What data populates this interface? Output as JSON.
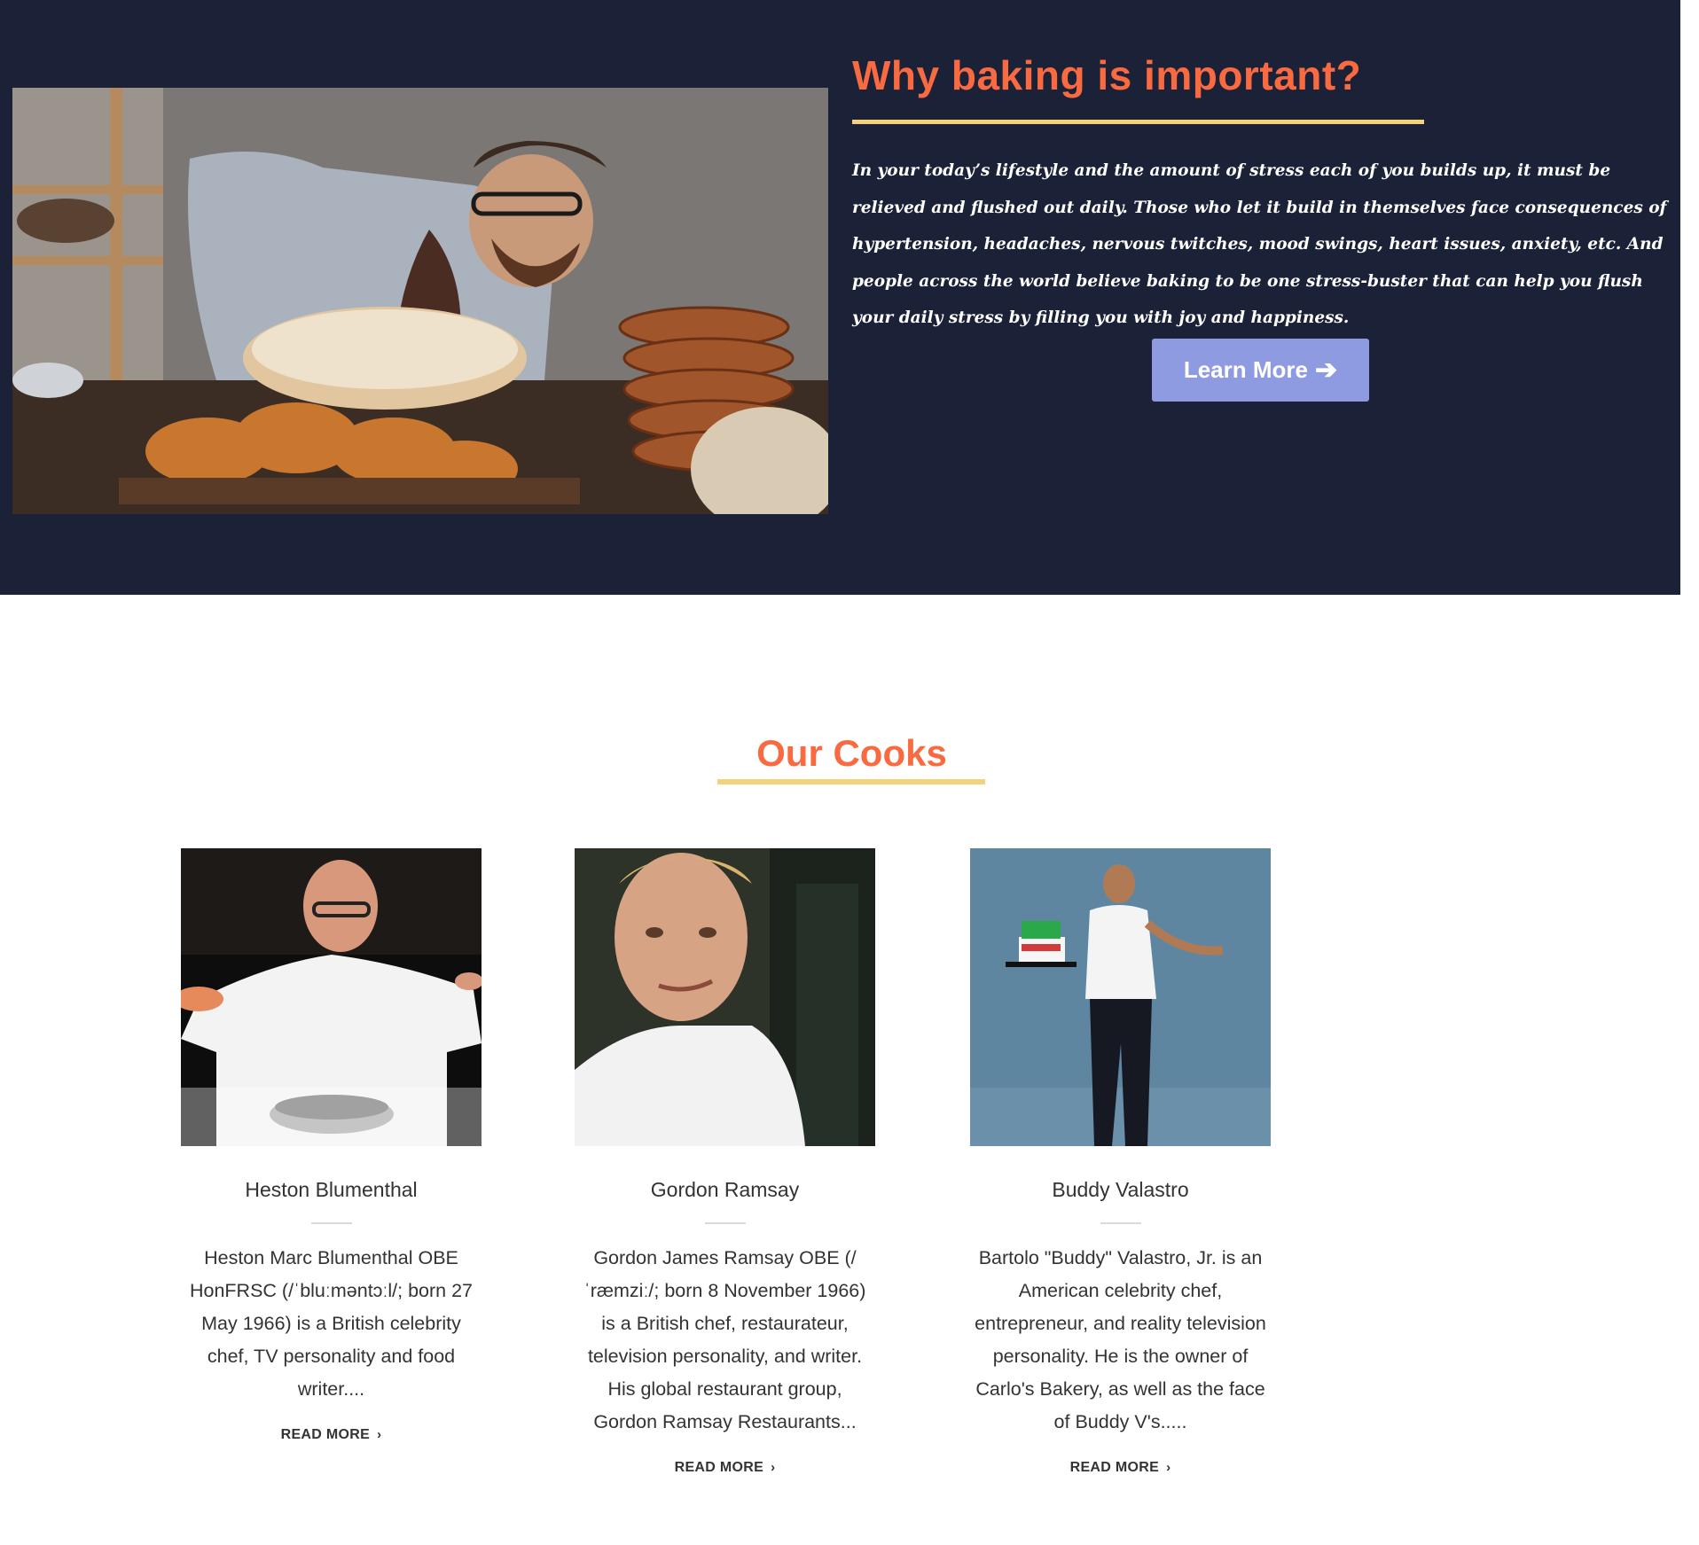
{
  "hero": {
    "title": "Why baking is important?",
    "text": "In your today’s lifestyle and the amount of stress each of you builds up, it must be relieved and flushed out daily. Those who let it build in themselves face consequences of hypertension, headaches, nervous twitches, mood swings, heart issues, anxiety, etc. And people across the world believe baking to be one stress-buster that can help you flush your daily stress by filling you with joy and happiness.",
    "button_label": "Learn More",
    "button_icon": "arrow-right-icon"
  },
  "cooks": {
    "title": "Our Cooks",
    "items": [
      {
        "name": "Heston Blumenthal",
        "description": "Heston Marc Blumenthal OBE HonFRSC (/ˈbluːməntɔːl/; born 27 May 1966) is a British celebrity chef, TV personality and food writer....",
        "link_label": "READ MORE"
      },
      {
        "name": "Gordon Ramsay",
        "description": "Gordon James Ramsay OBE (/ˈræmziː/; born 8 November 1966) is a British chef, restaurateur, television personality, and writer. His global restaurant group, Gordon Ramsay Restaurants...",
        "link_label": "READ MORE"
      },
      {
        "name": "Buddy Valastro",
        "description": "Bartolo \"Buddy\" Valastro, Jr. is an American celebrity chef, entrepreneur, and reality television personality. He is the owner of Carlo's Bakery, as well as the face of Buddy V's.....",
        "link_label": "READ MORE"
      }
    ]
  },
  "colors": {
    "hero_bg": "#1b2238",
    "accent_orange": "#fa6a41",
    "underline_yellow": "#f3d27a",
    "button_bg": "#8f9be0"
  }
}
